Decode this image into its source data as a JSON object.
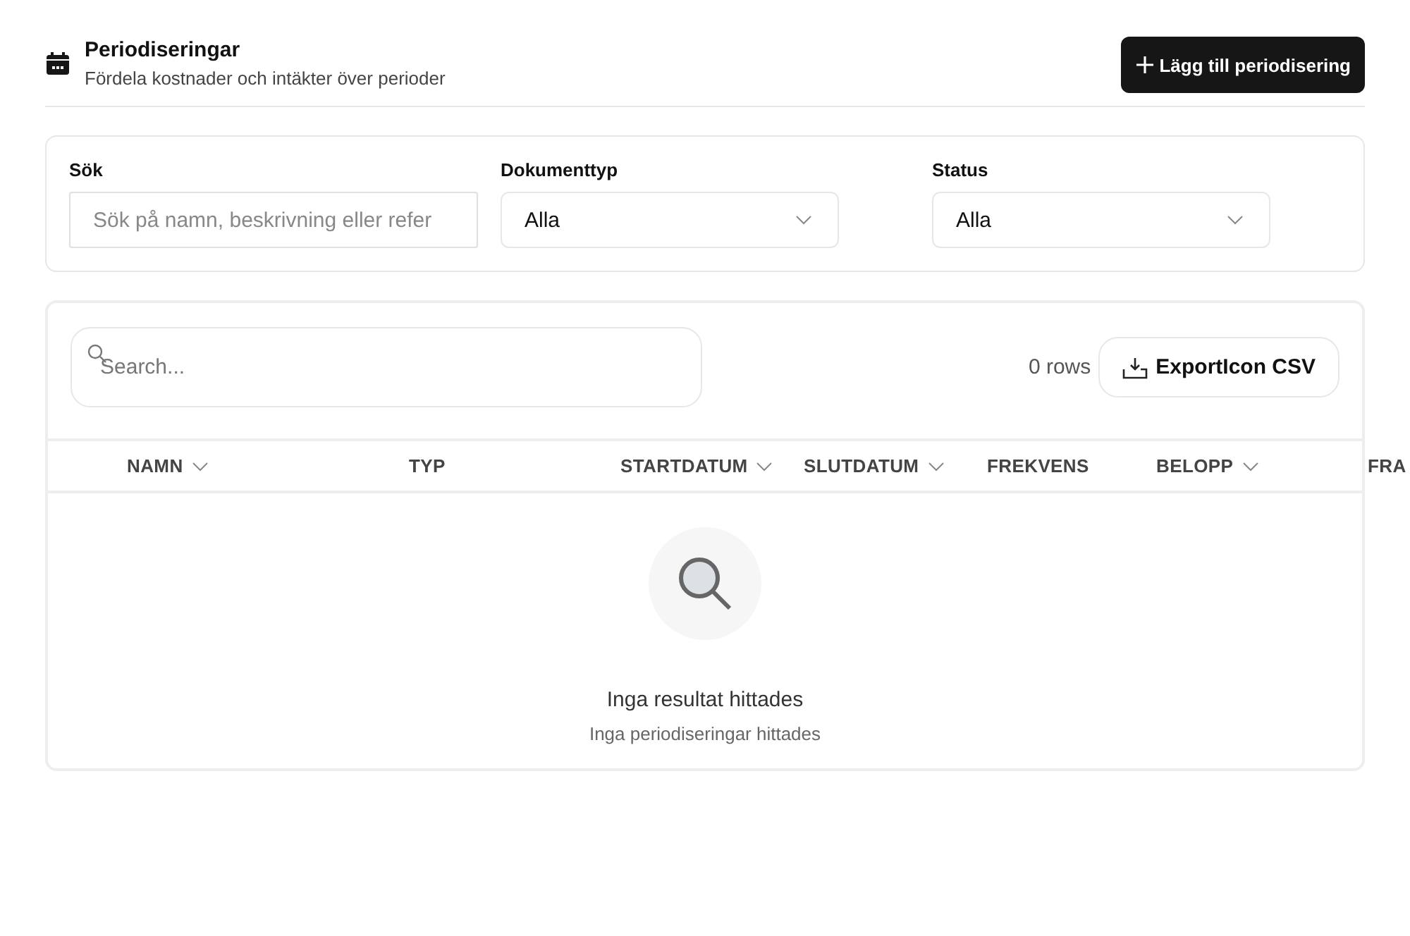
{
  "header": {
    "title": "Periodiseringar",
    "subtitle": "Fördela kostnader och intäkter över perioder",
    "add_button": "Lägg till periodisering"
  },
  "filters": [
    {
      "kind": "text",
      "label": "Sök",
      "placeholder": "Sök på namn, beskrivning eller refer"
    },
    {
      "kind": "select",
      "label": "Dokumenttyp",
      "value": "Alla"
    },
    {
      "kind": "select",
      "label": "Status",
      "value": "Alla"
    }
  ],
  "table": {
    "search_placeholder": "Search...",
    "row_count": "0 rows",
    "export_button": "ExportIcon CSV",
    "columns": [
      {
        "label": "NAMN",
        "sortable": true
      },
      {
        "label": "TYP",
        "sortable": false
      },
      {
        "label": "STARTDATUM",
        "sortable": true
      },
      {
        "label": "SLUTDATUM",
        "sortable": true
      },
      {
        "label": "FREKVENS",
        "sortable": false
      },
      {
        "label": "BELOPP",
        "sortable": true
      },
      {
        "label": "FRA"
      }
    ],
    "empty_title": "Inga resultat hittades",
    "empty_subtitle": "Inga periodiseringar hittades"
  }
}
